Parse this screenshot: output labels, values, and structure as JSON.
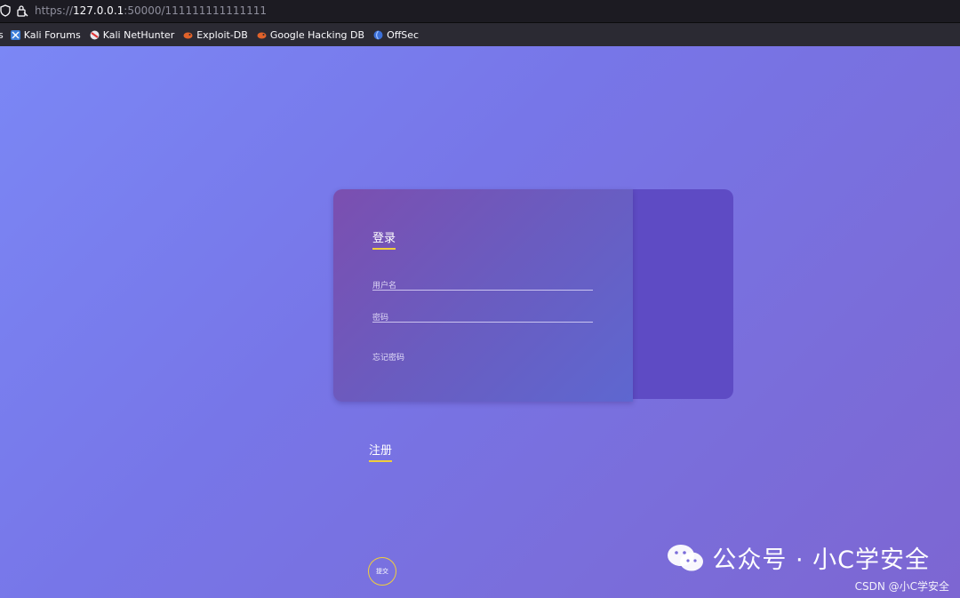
{
  "browser": {
    "url_prefix": "https://",
    "url_host": "127.0.0.1",
    "url_rest": ":50000/111111111111111",
    "bookmarks": [
      {
        "label": "s",
        "icon": "bookmark-cut-icon"
      },
      {
        "label": "Kali Forums",
        "icon": "kali-forums-icon"
      },
      {
        "label": "Kali NetHunter",
        "icon": "kali-nethunter-icon"
      },
      {
        "label": "Exploit-DB",
        "icon": "exploit-db-icon"
      },
      {
        "label": "Google Hacking DB",
        "icon": "google-hacking-db-icon"
      },
      {
        "label": "OffSec",
        "icon": "offsec-icon"
      }
    ]
  },
  "login": {
    "title": "登录",
    "username_placeholder": "用户名",
    "password_placeholder": "密码",
    "forgot": "忘记密码"
  },
  "register": {
    "title": "注册"
  },
  "submit_label": "提交",
  "watermark": {
    "main": "公众号 · 小C学安全",
    "sub": "CSDN @小C学安全"
  },
  "colors": {
    "accent": "#f2cf3a",
    "card_start": "#7b4fb0",
    "card_end": "#5e67d0",
    "side_panel": "#5e4bc4",
    "background_start": "#7b87f5",
    "background_end": "#7d66d2"
  }
}
